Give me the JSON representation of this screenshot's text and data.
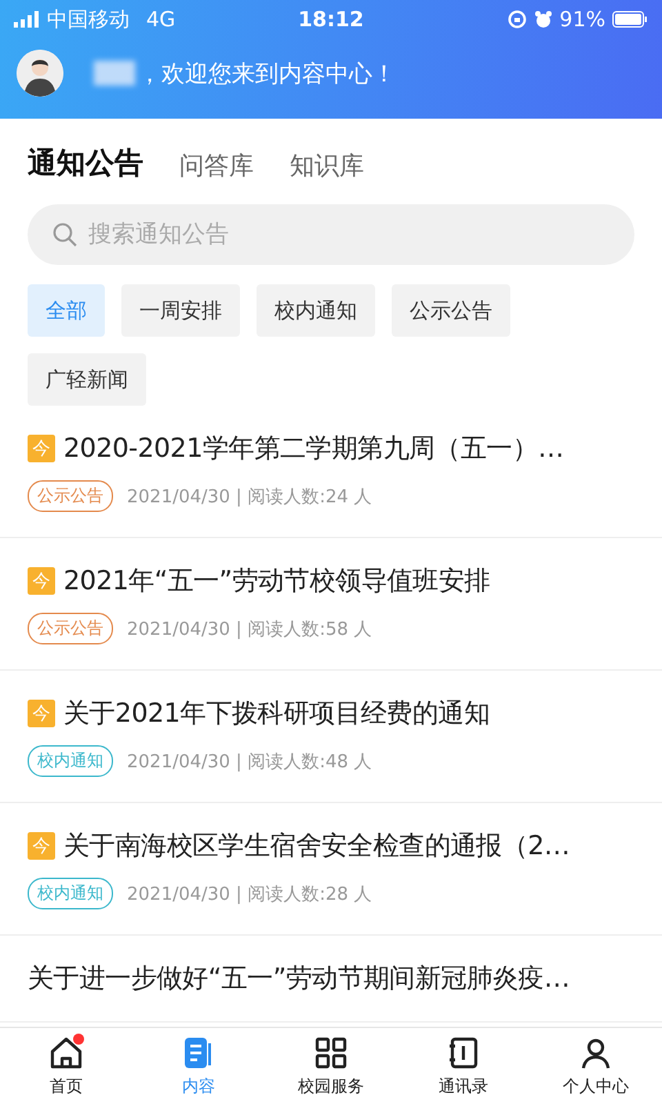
{
  "status_bar": {
    "carrier": "中国移动",
    "network": "4G",
    "time": "18:12",
    "battery": "91%"
  },
  "header": {
    "greeting": "，欢迎您来到内容中心！"
  },
  "tabs": [
    {
      "label": "通知公告",
      "selected": true
    },
    {
      "label": "问答库",
      "selected": false
    },
    {
      "label": "知识库",
      "selected": false
    }
  ],
  "search": {
    "placeholder": "搜索通知公告"
  },
  "filters": [
    {
      "label": "全部",
      "selected": true
    },
    {
      "label": "一周安排",
      "selected": false
    },
    {
      "label": "校内通知",
      "selected": false
    },
    {
      "label": "公示公告",
      "selected": false
    },
    {
      "label": "广轻新闻",
      "selected": false
    }
  ],
  "notices": [
    {
      "badge": "今",
      "title": "2020-2021学年第二学期第九周（五一）…",
      "tag": {
        "label": "公示公告",
        "color": "#e48a4d"
      },
      "meta": "2021/04/30 | 阅读人数:24 人"
    },
    {
      "badge": "今",
      "title": "2021年“五一”劳动节校领导值班安排",
      "tag": {
        "label": "公示公告",
        "color": "#e48a4d"
      },
      "meta": "2021/04/30 | 阅读人数:58 人"
    },
    {
      "badge": "今",
      "title": "关于2021年下拨科研项目经费的通知",
      "tag": {
        "label": "校内通知",
        "color": "#3cb8cc"
      },
      "meta": "2021/04/30 | 阅读人数:48 人"
    },
    {
      "badge": "今",
      "title": "关于南海校区学生宿舍安全检查的通报（2…",
      "tag": {
        "label": "校内通知",
        "color": "#3cb8cc"
      },
      "meta": "2021/04/30 | 阅读人数:28 人"
    },
    {
      "title": "关于进一步做好“五一”劳动节期间新冠肺炎疫…"
    }
  ],
  "nav": [
    {
      "label": "首页",
      "kind": "home",
      "selected": false,
      "dot": true
    },
    {
      "label": "内容",
      "kind": "content",
      "selected": true,
      "dot": false
    },
    {
      "label": "校园服务",
      "kind": "services",
      "selected": false,
      "dot": false
    },
    {
      "label": "通讯录",
      "kind": "contacts",
      "selected": false,
      "dot": false
    },
    {
      "label": "个人中心",
      "kind": "profile",
      "selected": false,
      "dot": false
    }
  ]
}
